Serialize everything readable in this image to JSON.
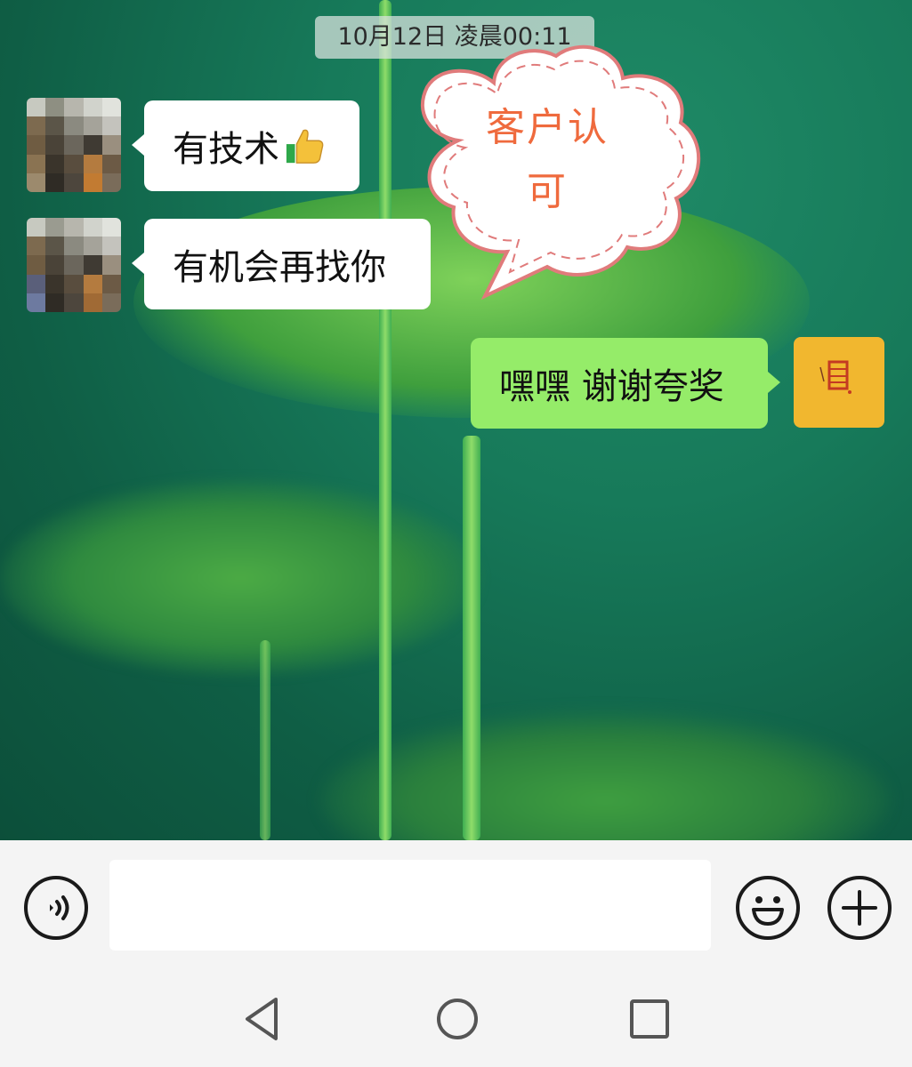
{
  "timestamp": "10月12日 凌晨00:11",
  "messages": [
    {
      "side": "in",
      "text": "有技术"
    },
    {
      "side": "in",
      "text": "有机会再找你"
    },
    {
      "side": "out",
      "text": "嘿嘿 谢谢夸奖"
    }
  ],
  "annotation": {
    "line1": "客户认",
    "line2": "可"
  },
  "colors": {
    "outgoing_bubble": "#95ec69",
    "incoming_bubble": "#ffffff",
    "annotation_text": "#ef6a3d",
    "annotation_border": "#e07b7b",
    "my_avatar": "#f1b72f"
  },
  "icons": {
    "voice": "voice-wave-icon",
    "emoji": "smiley-icon",
    "more": "plus-icon",
    "back": "triangle-back-icon",
    "home": "circle-home-icon",
    "recents": "square-recents-icon",
    "reaction": "thumbs-up-icon"
  }
}
